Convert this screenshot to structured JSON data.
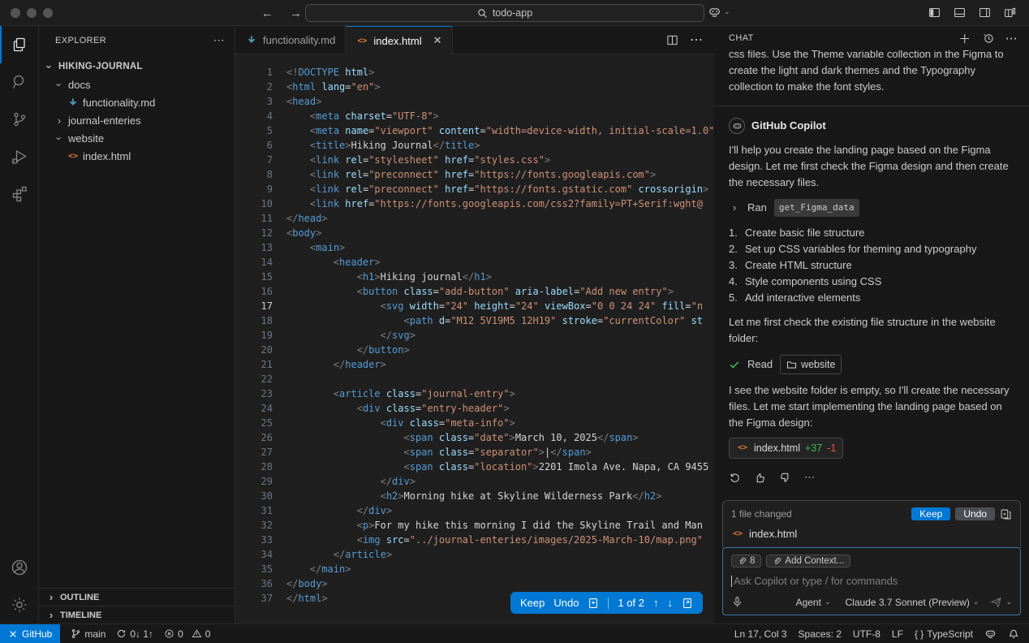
{
  "title_bar": {
    "search_text": "todo-app"
  },
  "explorer": {
    "header": "EXPLORER",
    "root": "HIKING-JOURNAL",
    "items": [
      {
        "label": "docs",
        "indent": 1,
        "chevron": "down"
      },
      {
        "label": "functionality.md",
        "indent": 2,
        "icon": "markdown"
      },
      {
        "label": "journal-enteries",
        "indent": 1,
        "chevron": "right"
      },
      {
        "label": "website",
        "indent": 1,
        "chevron": "down"
      },
      {
        "label": "index.html",
        "indent": 2,
        "icon": "html"
      }
    ],
    "outline": "OUTLINE",
    "timeline": "TIMELINE"
  },
  "tabs": [
    {
      "label": "functionality.md"
    },
    {
      "label": "index.html"
    }
  ],
  "editor": {
    "active_line": "17",
    "review_bar": {
      "keep": "Keep",
      "undo": "Undo",
      "position": "1 of 2"
    },
    "lines": [
      {
        "n": "1",
        "segs": [
          [
            "p",
            "<!"
          ],
          [
            "t",
            "DOCTYPE"
          ],
          [
            "a",
            " html"
          ],
          [
            "p",
            ">"
          ]
        ]
      },
      {
        "n": "2",
        "segs": [
          [
            "p",
            "<"
          ],
          [
            "t",
            "html"
          ],
          [
            "a",
            " lang"
          ],
          [
            "x",
            "="
          ],
          [
            "s",
            "\"en\""
          ],
          [
            "p",
            ">"
          ]
        ]
      },
      {
        "n": "3",
        "segs": [
          [
            "p",
            "<"
          ],
          [
            "t",
            "head"
          ],
          [
            "p",
            ">"
          ]
        ]
      },
      {
        "n": "4",
        "segs": [
          [
            "x",
            "    "
          ],
          [
            "p",
            "<"
          ],
          [
            "t",
            "meta"
          ],
          [
            "a",
            " charset"
          ],
          [
            "x",
            "="
          ],
          [
            "s",
            "\"UTF-8\""
          ],
          [
            "p",
            ">"
          ]
        ]
      },
      {
        "n": "5",
        "segs": [
          [
            "x",
            "    "
          ],
          [
            "p",
            "<"
          ],
          [
            "t",
            "meta"
          ],
          [
            "a",
            " name"
          ],
          [
            "x",
            "="
          ],
          [
            "s",
            "\"viewport\""
          ],
          [
            "a",
            " content"
          ],
          [
            "x",
            "="
          ],
          [
            "s",
            "\"width=device-width, initial-scale=1.0\""
          ],
          [
            "p",
            ">"
          ]
        ]
      },
      {
        "n": "6",
        "segs": [
          [
            "x",
            "    "
          ],
          [
            "p",
            "<"
          ],
          [
            "t",
            "title"
          ],
          [
            "p",
            ">"
          ],
          [
            "x",
            "Hiking Journal"
          ],
          [
            "p",
            "</"
          ],
          [
            "t",
            "title"
          ],
          [
            "p",
            ">"
          ]
        ]
      },
      {
        "n": "7",
        "segs": [
          [
            "x",
            "    "
          ],
          [
            "p",
            "<"
          ],
          [
            "t",
            "link"
          ],
          [
            "a",
            " rel"
          ],
          [
            "x",
            "="
          ],
          [
            "s",
            "\"stylesheet\""
          ],
          [
            "a",
            " href"
          ],
          [
            "x",
            "="
          ],
          [
            "s",
            "\"styles.css\""
          ],
          [
            "p",
            ">"
          ]
        ]
      },
      {
        "n": "8",
        "segs": [
          [
            "x",
            "    "
          ],
          [
            "p",
            "<"
          ],
          [
            "t",
            "link"
          ],
          [
            "a",
            " rel"
          ],
          [
            "x",
            "="
          ],
          [
            "s",
            "\"preconnect\""
          ],
          [
            "a",
            " href"
          ],
          [
            "x",
            "="
          ],
          [
            "s",
            "\"https://fonts.googleapis.com\""
          ],
          [
            "p",
            ">"
          ]
        ]
      },
      {
        "n": "9",
        "segs": [
          [
            "x",
            "    "
          ],
          [
            "p",
            "<"
          ],
          [
            "t",
            "link"
          ],
          [
            "a",
            " rel"
          ],
          [
            "x",
            "="
          ],
          [
            "s",
            "\"preconnect\""
          ],
          [
            "a",
            " href"
          ],
          [
            "x",
            "="
          ],
          [
            "s",
            "\"https://fonts.gstatic.com\""
          ],
          [
            "a",
            " crossorigin"
          ],
          [
            "p",
            ">"
          ]
        ]
      },
      {
        "n": "10",
        "segs": [
          [
            "x",
            "    "
          ],
          [
            "p",
            "<"
          ],
          [
            "t",
            "link"
          ],
          [
            "a",
            " href"
          ],
          [
            "x",
            "="
          ],
          [
            "s",
            "\"https://fonts.googleapis.com/css2?family=PT+Serif:wght@"
          ]
        ]
      },
      {
        "n": "11",
        "segs": [
          [
            "p",
            "</"
          ],
          [
            "t",
            "head"
          ],
          [
            "p",
            ">"
          ]
        ]
      },
      {
        "n": "12",
        "segs": [
          [
            "p",
            "<"
          ],
          [
            "t",
            "body"
          ],
          [
            "p",
            ">"
          ]
        ]
      },
      {
        "n": "13",
        "segs": [
          [
            "x",
            "    "
          ],
          [
            "p",
            "<"
          ],
          [
            "t",
            "main"
          ],
          [
            "p",
            ">"
          ]
        ]
      },
      {
        "n": "14",
        "segs": [
          [
            "x",
            "        "
          ],
          [
            "p",
            "<"
          ],
          [
            "t",
            "header"
          ],
          [
            "p",
            ">"
          ]
        ]
      },
      {
        "n": "15",
        "segs": [
          [
            "x",
            "            "
          ],
          [
            "p",
            "<"
          ],
          [
            "t",
            "h1"
          ],
          [
            "p",
            ">"
          ],
          [
            "x",
            "Hiking journal"
          ],
          [
            "p",
            "</"
          ],
          [
            "t",
            "h1"
          ],
          [
            "p",
            ">"
          ]
        ]
      },
      {
        "n": "16",
        "segs": [
          [
            "x",
            "            "
          ],
          [
            "p",
            "<"
          ],
          [
            "t",
            "button"
          ],
          [
            "a",
            " class"
          ],
          [
            "x",
            "="
          ],
          [
            "s",
            "\"add-button\""
          ],
          [
            "a",
            " aria-label"
          ],
          [
            "x",
            "="
          ],
          [
            "s",
            "\"Add new entry\""
          ],
          [
            "p",
            ">"
          ]
        ]
      },
      {
        "n": "17",
        "segs": [
          [
            "x",
            "                "
          ],
          [
            "p",
            "<"
          ],
          [
            "t",
            "svg"
          ],
          [
            "a",
            " width"
          ],
          [
            "x",
            "="
          ],
          [
            "s",
            "\"24\""
          ],
          [
            "a",
            " height"
          ],
          [
            "x",
            "="
          ],
          [
            "s",
            "\"24\""
          ],
          [
            "a",
            " viewBox"
          ],
          [
            "x",
            "="
          ],
          [
            "s",
            "\"0 0 24 24\""
          ],
          [
            "a",
            " fill"
          ],
          [
            "x",
            "="
          ],
          [
            "s",
            "\"n"
          ]
        ]
      },
      {
        "n": "18",
        "segs": [
          [
            "x",
            "                    "
          ],
          [
            "p",
            "<"
          ],
          [
            "t",
            "path"
          ],
          [
            "a",
            " d"
          ],
          [
            "x",
            "="
          ],
          [
            "s",
            "\"M12 5V19M5 12H19\""
          ],
          [
            "a",
            " stroke"
          ],
          [
            "x",
            "="
          ],
          [
            "s",
            "\"currentColor\""
          ],
          [
            "a",
            " st"
          ]
        ]
      },
      {
        "n": "19",
        "segs": [
          [
            "x",
            "                "
          ],
          [
            "p",
            "</"
          ],
          [
            "t",
            "svg"
          ],
          [
            "p",
            ">"
          ]
        ]
      },
      {
        "n": "20",
        "segs": [
          [
            "x",
            "            "
          ],
          [
            "p",
            "</"
          ],
          [
            "t",
            "button"
          ],
          [
            "p",
            ">"
          ]
        ]
      },
      {
        "n": "21",
        "segs": [
          [
            "x",
            "        "
          ],
          [
            "p",
            "</"
          ],
          [
            "t",
            "header"
          ],
          [
            "p",
            ">"
          ]
        ]
      },
      {
        "n": "22",
        "segs": []
      },
      {
        "n": "23",
        "segs": [
          [
            "x",
            "        "
          ],
          [
            "p",
            "<"
          ],
          [
            "t",
            "article"
          ],
          [
            "a",
            " class"
          ],
          [
            "x",
            "="
          ],
          [
            "s",
            "\"journal-entry\""
          ],
          [
            "p",
            ">"
          ]
        ]
      },
      {
        "n": "24",
        "segs": [
          [
            "x",
            "            "
          ],
          [
            "p",
            "<"
          ],
          [
            "t",
            "div"
          ],
          [
            "a",
            " class"
          ],
          [
            "x",
            "="
          ],
          [
            "s",
            "\"entry-header\""
          ],
          [
            "p",
            ">"
          ]
        ]
      },
      {
        "n": "25",
        "segs": [
          [
            "x",
            "                "
          ],
          [
            "p",
            "<"
          ],
          [
            "t",
            "div"
          ],
          [
            "a",
            " class"
          ],
          [
            "x",
            "="
          ],
          [
            "s",
            "\"meta-info\""
          ],
          [
            "p",
            ">"
          ]
        ]
      },
      {
        "n": "26",
        "segs": [
          [
            "x",
            "                    "
          ],
          [
            "p",
            "<"
          ],
          [
            "t",
            "span"
          ],
          [
            "a",
            " class"
          ],
          [
            "x",
            "="
          ],
          [
            "s",
            "\"date\""
          ],
          [
            "p",
            ">"
          ],
          [
            "x",
            "March 10, 2025"
          ],
          [
            "p",
            "</"
          ],
          [
            "t",
            "span"
          ],
          [
            "p",
            ">"
          ]
        ]
      },
      {
        "n": "27",
        "segs": [
          [
            "x",
            "                    "
          ],
          [
            "p",
            "<"
          ],
          [
            "t",
            "span"
          ],
          [
            "a",
            " class"
          ],
          [
            "x",
            "="
          ],
          [
            "s",
            "\"separator\""
          ],
          [
            "p",
            ">"
          ],
          [
            "x",
            "|"
          ],
          [
            "p",
            "</"
          ],
          [
            "t",
            "span"
          ],
          [
            "p",
            ">"
          ]
        ]
      },
      {
        "n": "28",
        "segs": [
          [
            "x",
            "                    "
          ],
          [
            "p",
            "<"
          ],
          [
            "t",
            "span"
          ],
          [
            "a",
            " class"
          ],
          [
            "x",
            "="
          ],
          [
            "s",
            "\"location\""
          ],
          [
            "p",
            ">"
          ],
          [
            "x",
            "2201 Imola Ave. Napa, CA 9455"
          ]
        ]
      },
      {
        "n": "29",
        "segs": [
          [
            "x",
            "                "
          ],
          [
            "p",
            "</"
          ],
          [
            "t",
            "div"
          ],
          [
            "p",
            ">"
          ]
        ]
      },
      {
        "n": "30",
        "segs": [
          [
            "x",
            "                "
          ],
          [
            "p",
            "<"
          ],
          [
            "t",
            "h2"
          ],
          [
            "p",
            ">"
          ],
          [
            "x",
            "Morning hike at Skyline Wilderness Park"
          ],
          [
            "p",
            "</"
          ],
          [
            "t",
            "h2"
          ],
          [
            "p",
            ">"
          ]
        ]
      },
      {
        "n": "31",
        "segs": [
          [
            "x",
            "            "
          ],
          [
            "p",
            "</"
          ],
          [
            "t",
            "div"
          ],
          [
            "p",
            ">"
          ]
        ]
      },
      {
        "n": "32",
        "segs": [
          [
            "x",
            "            "
          ],
          [
            "p",
            "<"
          ],
          [
            "t",
            "p"
          ],
          [
            "p",
            ">"
          ],
          [
            "x",
            "For my hike this morning I did the Skyline Trail and Man"
          ]
        ]
      },
      {
        "n": "33",
        "segs": [
          [
            "x",
            "            "
          ],
          [
            "p",
            "<"
          ],
          [
            "t",
            "img"
          ],
          [
            "a",
            " src"
          ],
          [
            "x",
            "="
          ],
          [
            "s",
            "\"../journal-enteries/images/2025-March-10/map.png\""
          ]
        ]
      },
      {
        "n": "34",
        "segs": [
          [
            "x",
            "        "
          ],
          [
            "p",
            "</"
          ],
          [
            "t",
            "article"
          ],
          [
            "p",
            ">"
          ]
        ]
      },
      {
        "n": "35",
        "segs": [
          [
            "x",
            "    "
          ],
          [
            "p",
            "</"
          ],
          [
            "t",
            "main"
          ],
          [
            "p",
            ">"
          ]
        ]
      },
      {
        "n": "36",
        "segs": [
          [
            "p",
            "</"
          ],
          [
            "t",
            "body"
          ],
          [
            "p",
            ">"
          ]
        ]
      },
      {
        "n": "37",
        "segs": [
          [
            "p",
            "</"
          ],
          [
            "t",
            "html"
          ],
          [
            "p",
            ">"
          ]
        ]
      }
    ]
  },
  "chat": {
    "title": "CHAT",
    "user_message": "css files. Use the Theme variable collection in the Figma to create the light and dark themes and the Typography collection to make the font styles.",
    "copilot_name": "GitHub Copilot",
    "intro": "I'll help you create the landing page based on the Figma design. Let me first check the Figma design and then create the necessary files.",
    "ran_label": "Ran",
    "ran_tool": "get_Figma_data",
    "steps": [
      "Create basic file structure",
      "Set up CSS variables for theming and typography",
      "Create HTML structure",
      "Style components using CSS",
      "Add interactive elements"
    ],
    "check_text": "Let me first check the existing file structure in the website folder:",
    "read_label": "Read",
    "read_target": "website",
    "empty_text": "I see the website folder is empty, so I'll create the necessary files. Let me start implementing the landing page based on the Figma design:",
    "file_chip": {
      "name": "index.html",
      "added": "+37",
      "removed": "-1"
    },
    "edits_panel": {
      "summary": "1 file changed",
      "keep": "Keep",
      "undo": "Undo",
      "file": "index.html"
    },
    "input": {
      "attach_count": "8",
      "add_context": "Add Context...",
      "placeholder": "Ask Copilot or type / for commands",
      "mode": "Agent",
      "model": "Claude 3.7 Sonnet (Preview)"
    }
  },
  "status_bar": {
    "remote": "GitHub",
    "branch": "main",
    "sync": "0↓ 1↑",
    "errors": "0",
    "warnings": "0",
    "line_col": "Ln 17, Col 3",
    "spaces": "Spaces: 2",
    "encoding": "UTF-8",
    "eol": "LF",
    "braces_icon": "{ }",
    "language": "TypeScript"
  }
}
